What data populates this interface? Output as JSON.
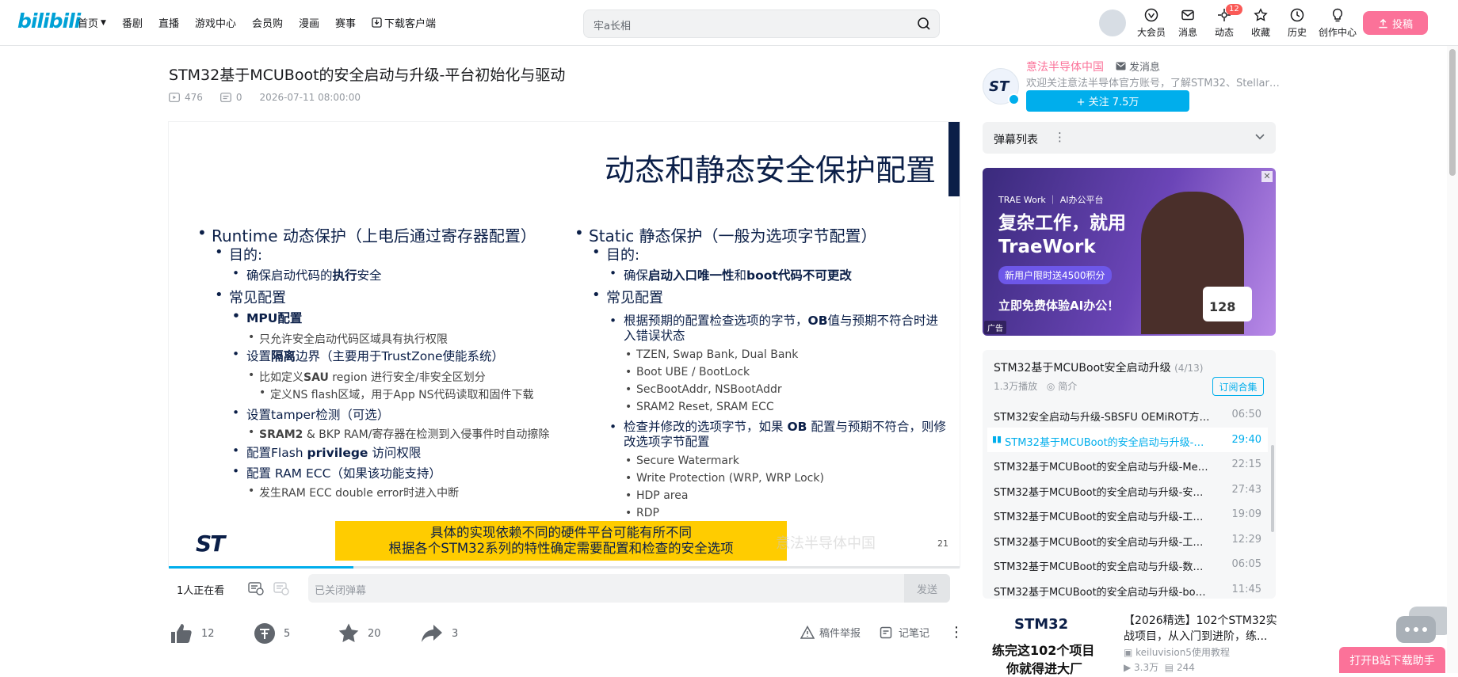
{
  "header": {
    "logo": "bilibili",
    "nav": [
      "首页",
      "番剧",
      "直播",
      "游戏中心",
      "会员购",
      "漫画",
      "赛事",
      "下载客户端"
    ],
    "search_placeholder": "牢a长相",
    "right_items": [
      {
        "label": "大会员",
        "icon": "vip-icon"
      },
      {
        "label": "消息",
        "icon": "message-icon"
      },
      {
        "label": "动态",
        "icon": "dynamic-icon",
        "badge": "12"
      },
      {
        "label": "收藏",
        "icon": "star-icon"
      },
      {
        "label": "历史",
        "icon": "history-icon"
      },
      {
        "label": "创作中心",
        "icon": "bulb-icon"
      }
    ],
    "upload": "投稿"
  },
  "video": {
    "title": "STM32基于MCUBoot的安全启动与升级-平台初始化与驱动",
    "plays": "476",
    "danmaku": "0",
    "date": "2026-07-11 08:00:00",
    "progress_fraction": 0.233
  },
  "slide": {
    "title": "动态和静态安全保护配置",
    "left": {
      "l1": "Runtime 动态保护（上电后通过寄存器配置）",
      "purpose": "目的:",
      "purpose_item_a": "确保启动代码的",
      "purpose_item_b": "执行",
      "purpose_item_c": "安全",
      "common": "常见配置",
      "mpu": "MPU配置",
      "mpu_sub": "只允许安全启动代码区域具有执行权限",
      "iso_a": "设置",
      "iso_b": "隔离",
      "iso_c": "边界（主要用于TrustZone使能系统）",
      "sau_a": "比如定义",
      "sau_b": "SAU",
      "sau_c": " region 进行安全/非安全区划分",
      "ns": "定义NS flash区域，用于App NS代码读取和固件下载",
      "tamper": "设置tamper检测（可选）",
      "sram_a": "SRAM2",
      "sram_b": " & BKP RAM/寄存器在检测到入侵事件时自动擦除",
      "flash_a": "配置Flash ",
      "flash_b": "privilege",
      "flash_c": " 访问权限",
      "ecc": "配置 RAM ECC（如果该功能支持）",
      "ecc_sub": "发生RAM ECC double error时进入中断"
    },
    "right": {
      "l1": "Static 静态保护（一般为选项字节配置）",
      "purpose": "目的:",
      "purpose_a": "确保",
      "purpose_b": "启动入口唯一性",
      "purpose_c": "和",
      "purpose_d": "boot代码不可更改",
      "common": "常见配置",
      "check_a": "根据预期的配置检查选项的字节，",
      "check_b": "OB",
      "check_c": "值与预期不符合时进入错误状态",
      "items1": [
        "TZEN, Swap Bank, Dual Bank",
        "Boot UBE / BootLock",
        "SecBootAddr, NSBootAddr",
        "SRAM2 Reset, SRAM ECC"
      ],
      "mod_a": "检查并修改的选项字节，如果 ",
      "mod_b": "OB",
      "mod_c": " 配置与预期不符合，则修改选项字节配置",
      "items2": [
        "Secure Watermark",
        "Write Protection (WRP, WRP Lock)",
        "HDP area",
        "RDP"
      ]
    },
    "note_line1": "具体的实现依赖不同的硬件平台可能有所不同",
    "note_line2": "根据各个STM32系列的特性确定需要配置和检查的安全选项",
    "logo": "ST",
    "page": "21",
    "watermark": "意法半导体中国"
  },
  "danmaku_bar": {
    "watching": "1人正在看",
    "placeholder": "已关闭弹幕",
    "send": "发送"
  },
  "toolbar": {
    "like": "12",
    "coin": "5",
    "fav": "20",
    "share": "3",
    "report": "稿件举报",
    "note": "记笔记"
  },
  "uploader": {
    "name": "意法半导体中国",
    "message": "发消息",
    "desc": "欢迎关注意法半导体官方账号，了解STM32、Stellar微...",
    "follow": "+ 关注 7.5万"
  },
  "danmaku_list": {
    "title": "弹幕列表"
  },
  "ad": {
    "brand": "TRAE Work ｜ AI办公平台",
    "headline": "复杂工作，就用\nTraeWork",
    "pill": "新用户限时送4500积分",
    "cta": "立即免费体验AI办公！",
    "card_value": "128",
    "tag": "广告"
  },
  "collection": {
    "title": "STM32基于MCUBoot安全启动升级",
    "count": "(4/13)",
    "plays": "1.3万播放",
    "intro": "简介",
    "subscribe": "订阅合集",
    "episodes": [
      {
        "name": "STM32安全启动与升级-SBSFU OEMiROT方案...",
        "dur": "06:50"
      },
      {
        "name": "STM32基于MCUBoot的安全启动与升级-平台初始化与驱动",
        "dur": "29:40",
        "active": true
      },
      {
        "name": "STM32基于MCUBoot的安全启动与升级-Memory...",
        "dur": "22:15"
      },
      {
        "name": "STM32基于MCUBoot的安全启动与升级-安全启动...",
        "dur": "27:43"
      },
      {
        "name": "STM32基于MCUBoot的安全启动与升级-工程的...",
        "dur": "19:09"
      },
      {
        "name": "STM32基于MCUBoot的安全启动与升级-工程B...",
        "dur": "12:29"
      },
      {
        "name": "STM32基于MCUBoot的安全启动与升级-数据与...",
        "dur": "06:05"
      },
      {
        "name": "STM32基于MCUBoot的安全启动与升级-boot_g...",
        "dur": "11:45"
      }
    ]
  },
  "recommend": {
    "thumb_brand": "STM32",
    "thumb_line1": "练完这102个项目",
    "thumb_line2": "你就得进大厂",
    "title": "【2026精选】102个STM32实战项目，从入门到进阶，练...",
    "uploader": "keiluvision5使用教程",
    "plays": "3.3万",
    "danmaku": "244"
  },
  "float_button": "打开B站下载助手",
  "colors": {
    "accent": "#00aeec",
    "pink": "#fb7299",
    "slide_navy": "#0b1f48",
    "note_yellow": "#ffcc00"
  }
}
